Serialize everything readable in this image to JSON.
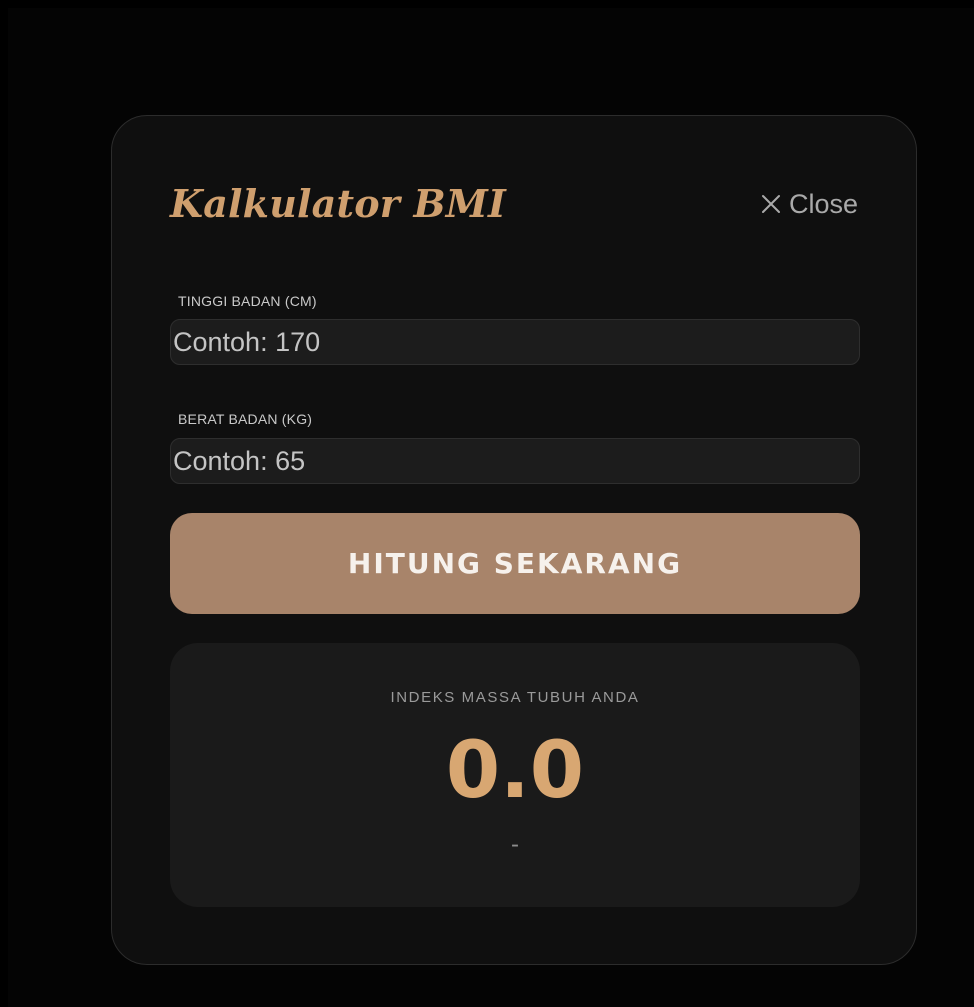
{
  "modal": {
    "title": "Kalkulator BMI",
    "close_label": "Close",
    "close_icon": "close-icon"
  },
  "form": {
    "height": {
      "label": "TINGGI BADAN (CM)",
      "placeholder": "Contoh: 170",
      "value": ""
    },
    "weight": {
      "label": "BERAT BADAN (KG)",
      "placeholder": "Contoh: 65",
      "value": ""
    },
    "submit_label": "HITUNG SEKARANG"
  },
  "result": {
    "label": "INDEKS MASSA TUBUH ANDA",
    "value": "0.0",
    "category": "-"
  },
  "colors": {
    "accent": "#cf9f6e",
    "button": "#a8846a",
    "result_value": "#d8a772",
    "modal_bg": "#0f0f0f",
    "page_bg": "#000000"
  }
}
